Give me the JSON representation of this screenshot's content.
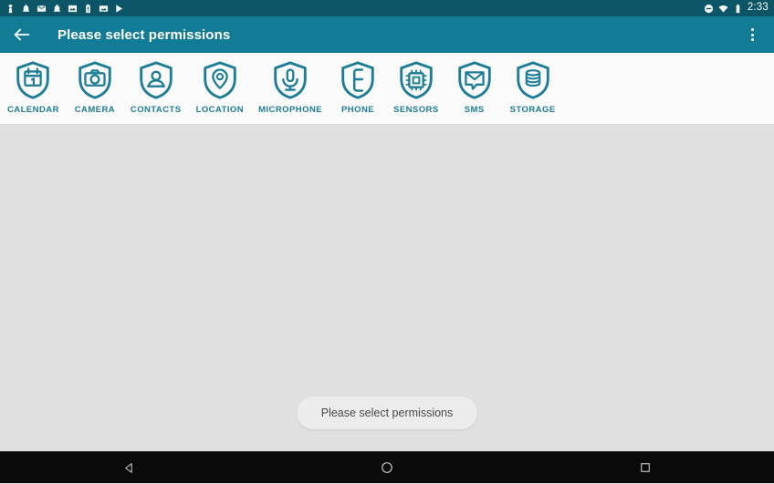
{
  "statusbar": {
    "time": "2:33",
    "left_icons": [
      {
        "name": "person-icon"
      },
      {
        "name": "notification-bell-icon"
      },
      {
        "name": "email-icon"
      },
      {
        "name": "notification-bell-icon"
      },
      {
        "name": "image-icon"
      },
      {
        "name": "battery-alert-icon"
      },
      {
        "name": "photo-icon"
      },
      {
        "name": "play-icon"
      }
    ],
    "right_icons": [
      {
        "name": "do-not-disturb-icon"
      },
      {
        "name": "wifi-icon"
      },
      {
        "name": "battery-icon"
      }
    ]
  },
  "toolbar": {
    "back_label": "Navigate up",
    "title": "Please select permissions",
    "overflow_label": "More options"
  },
  "tabs": [
    {
      "label": "CALENDAR",
      "icon": "shield-calendar-icon"
    },
    {
      "label": "CAMERA",
      "icon": "shield-camera-icon"
    },
    {
      "label": "CONTACTS",
      "icon": "shield-contacts-icon"
    },
    {
      "label": "LOCATION",
      "icon": "shield-location-icon"
    },
    {
      "label": "MICROPHONE",
      "icon": "shield-microphone-icon"
    },
    {
      "label": "PHONE",
      "icon": "shield-phone-icon"
    },
    {
      "label": "SENSORS",
      "icon": "shield-sensors-icon"
    },
    {
      "label": "SMS",
      "icon": "shield-sms-icon"
    },
    {
      "label": "STORAGE",
      "icon": "shield-storage-icon"
    }
  ],
  "content": {
    "toast_message": "Please select permissions"
  },
  "navbar": {
    "back_label": "Back",
    "home_label": "Home",
    "recents_label": "Recents"
  },
  "colors": {
    "status_bar": "#0b5566",
    "toolbar": "#127b96",
    "accent": "#1d7d96",
    "tab_strip_bg": "#fafafa",
    "content_bg": "#e0e0e0",
    "toast_bg": "#ececec",
    "nav_bar": "#0a0a0a"
  }
}
